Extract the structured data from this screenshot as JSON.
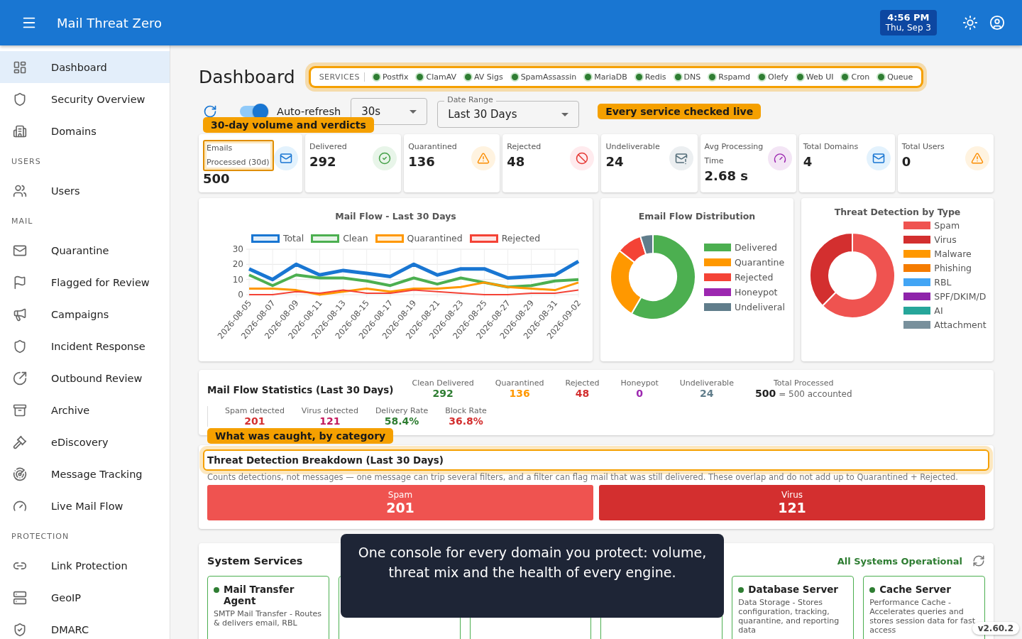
{
  "app_bar": {
    "title": "Mail Threat Zero",
    "time": "4:56 PM",
    "date": "Thu, Sep 3"
  },
  "sidebar": [
    {
      "items": [
        {
          "label": "Dashboard",
          "selected": true
        },
        {
          "label": "Security Overview",
          "selected": false
        },
        {
          "label": "Domains",
          "selected": false
        }
      ]
    },
    {
      "heading": "USERS",
      "items": [
        {
          "label": "Users",
          "selected": false
        }
      ]
    },
    {
      "heading": "MAIL",
      "items": [
        {
          "label": "Quarantine",
          "selected": false
        },
        {
          "label": "Flagged for Review",
          "selected": false
        },
        {
          "label": "Campaigns",
          "selected": false
        },
        {
          "label": "Incident Response",
          "selected": false
        },
        {
          "label": "Outbound Review",
          "selected": false
        },
        {
          "label": "Archive",
          "selected": false
        },
        {
          "label": "eDiscovery",
          "selected": false
        },
        {
          "label": "Message Tracking",
          "selected": false
        },
        {
          "label": "Live Mail Flow",
          "selected": false
        }
      ]
    },
    {
      "heading": "PROTECTION",
      "items": [
        {
          "label": "Link Protection",
          "selected": false
        },
        {
          "label": "GeoIP",
          "selected": false
        },
        {
          "label": "DMARC",
          "selected": false
        }
      ]
    }
  ],
  "page_title": "Dashboard",
  "services_bar": {
    "label": "SERVICES",
    "services": [
      {
        "name": "Postfix",
        "on": true
      },
      {
        "name": "ClamAV",
        "on": true
      },
      {
        "name": "AV Sigs",
        "on": true
      },
      {
        "name": "SpamAssassin",
        "on": true
      },
      {
        "name": "MariaDB",
        "on": true
      },
      {
        "name": "Redis",
        "on": true
      },
      {
        "name": "DNS",
        "on": true
      },
      {
        "name": "Rspamd",
        "on": true
      },
      {
        "name": "Olefy",
        "on": true
      },
      {
        "name": "Web UI",
        "on": true
      },
      {
        "name": "Cron",
        "on": true
      },
      {
        "name": "Queue",
        "on": true
      }
    ]
  },
  "controls": {
    "auto_refresh": {
      "label": "Auto-refresh",
      "on": true
    },
    "interval": {
      "value": "30s"
    },
    "date_range": {
      "label": "Date Range",
      "value": "Last 30 Days"
    }
  },
  "callouts": [
    "Every service checked live",
    "30-day volume and verdicts",
    "What was caught, by category"
  ],
  "kpis": [
    {
      "label": "Emails Processed (30d)",
      "value": "500"
    },
    {
      "label": "Delivered",
      "value": "292"
    },
    {
      "label": "Quarantined",
      "value": "136"
    },
    {
      "label": "Rejected",
      "value": "48"
    },
    {
      "label": "Undeliverable",
      "value": "24"
    },
    {
      "label": "Avg Processing Time",
      "value": "2.68 s"
    },
    {
      "label": "Total Domains",
      "value": "4"
    },
    {
      "label": "Total Users",
      "value": "0"
    }
  ],
  "mail_flow": {
    "chart_data": {
      "type": "line",
      "title": "Mail Flow - Last 30 Days",
      "categories": [
        "2026-08-05",
        "2026-08-07",
        "2026-08-09",
        "2026-08-11",
        "2026-08-13",
        "2026-08-15",
        "2026-08-17",
        "2026-08-19",
        "2026-08-21",
        "2026-08-23",
        "2026-08-25",
        "2026-08-27",
        "2026-08-29",
        "2026-08-31",
        "2026-09-02"
      ],
      "ylim": [
        0,
        30
      ],
      "yticks": [
        0,
        10,
        20,
        30
      ],
      "grid": true,
      "series": [
        {
          "name": "Total",
          "color": "#1976d2",
          "values": [
            17,
            10,
            20,
            13,
            16,
            14,
            12,
            20,
            13,
            17,
            17,
            11,
            12,
            13,
            22
          ]
        },
        {
          "name": "Clean",
          "color": "#4caf50",
          "values": [
            13,
            6,
            13,
            11,
            11,
            9,
            6,
            11,
            7,
            11,
            8,
            5,
            6,
            9,
            10
          ]
        },
        {
          "name": "Quarantined",
          "color": "#ff9800",
          "values": [
            4,
            4,
            3,
            0,
            2,
            4,
            2,
            4,
            4,
            5,
            8,
            5,
            4,
            3,
            8
          ]
        },
        {
          "name": "Rejected",
          "color": "#f44336",
          "values": [
            0,
            0,
            2,
            1,
            3,
            1,
            1,
            3,
            2,
            1,
            0,
            0,
            1,
            1,
            3
          ]
        }
      ]
    }
  },
  "flow_distribution": {
    "chart_data": {
      "type": "donut",
      "title": "Email Flow Distribution",
      "categories": [
        "Delivered",
        "Quarantine",
        "Rejected",
        "Honeypot",
        "Undeliveral"
      ],
      "series": [
        {
          "values": [
            58.4,
            27.2,
            9.6,
            0,
            4.8
          ]
        }
      ],
      "colors": [
        "#4caf50",
        "#ff9800",
        "#f44336",
        "#9c27b0",
        "#607d8b"
      ]
    }
  },
  "threat_types": {
    "chart_data": {
      "type": "donut",
      "title": "Threat Detection by Type",
      "categories": [
        "Spam",
        "Virus",
        "Malware",
        "Phishing",
        "RBL",
        "SPF/DKIM/D",
        "AI",
        "Attachment"
      ],
      "series": [
        {
          "values": [
            62.4,
            37.6,
            0,
            0,
            0,
            0,
            0,
            0
          ]
        }
      ],
      "colors": [
        "#ef5350",
        "#d32f2f",
        "#ff9800",
        "#f57c00",
        "#42a5f5",
        "#8e24aa",
        "#26a69a",
        "#78909c"
      ]
    }
  },
  "stats": {
    "title": "Mail Flow Statistics (Last 30 Days)",
    "row_1": [
      {
        "label": "Clean Delivered",
        "value": "292",
        "color": "#2e7d32"
      },
      {
        "label": "Quarantined",
        "value": "136",
        "color": "#ff9800"
      },
      {
        "label": "Rejected",
        "value": "48",
        "color": "#d32f2f"
      },
      {
        "label": "Honeypot",
        "value": "0",
        "color": "#9c27b0"
      },
      {
        "label": "Undeliverable",
        "value": "24",
        "color": "#607d8b"
      }
    ],
    "total": {
      "label": "Total Processed",
      "value": "500",
      "note": "= 500 accounted"
    },
    "row_2": [
      {
        "label": "Spam detected",
        "value": "201",
        "color": "#d32f2f"
      },
      {
        "label": "Virus detected",
        "value": "121",
        "color": "#c2185b"
      },
      {
        "label": "Delivery Rate",
        "value": "58.4%",
        "color": "#2e7d32"
      },
      {
        "label": "Block Rate",
        "value": "36.8%",
        "color": "#d32f2f"
      }
    ]
  },
  "breakdown": {
    "title": "Threat Detection Breakdown (Last 30 Days)",
    "note": "Counts detections, not messages — one message can trip several filters, and a filter can flag mail that was still delivered. These overlap and do not add up to Quarantined + Rejected.",
    "tiles": [
      {
        "label": "Spam",
        "value": "201",
        "color": "#ef5350"
      },
      {
        "label": "Virus",
        "value": "121",
        "color": "#d32f2f"
      }
    ]
  },
  "system_services": {
    "title": "System Services",
    "status": "All Systems Operational",
    "cards": [
      {
        "name": "Mail Transfer Agent",
        "description": "SMTP Mail Transfer - Routes & delivers email, RBL",
        "online": true
      },
      {
        "online": true
      },
      {
        "online": true
      },
      {
        "online": true
      },
      {
        "name": "Database Server",
        "description": "Data Storage - Stores configuration, tracking, quarantine, and reporting data",
        "online": true
      },
      {
        "name": "Cache Server",
        "description": "Performance Cache - Accelerates queries and stores session data for fast access",
        "online": true
      }
    ]
  },
  "caption": "One console for every domain you protect: volume, threat mix and the health of every engine.",
  "version": "v2.60.2"
}
